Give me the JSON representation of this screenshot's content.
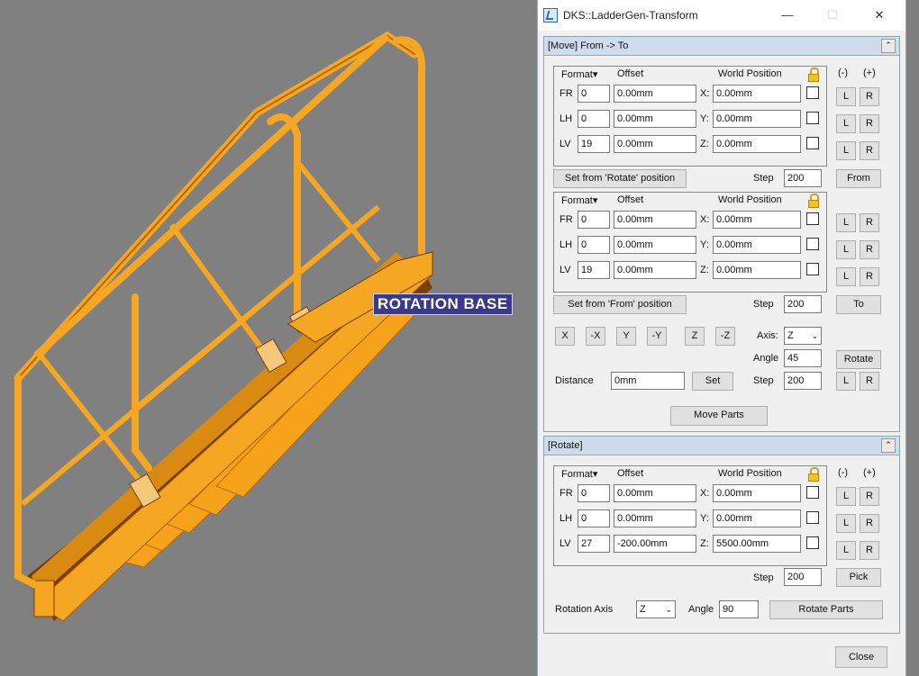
{
  "viewport": {
    "annotation": "ROTATION BASE"
  },
  "window": {
    "title": "DKS::LadderGen-Transform",
    "minimize": "—",
    "maximize": "☐",
    "close": "✕"
  },
  "move_panel": {
    "header": "[Move] From -> To",
    "collapse": "⌃",
    "minus": "(-)",
    "plus": "(+)",
    "from_group": {
      "format": "Format▾",
      "offset": "Offset",
      "world": "World Position",
      "rows": [
        {
          "label": "FR",
          "idx": "0",
          "offset": "0.00mm",
          "axis": "X:",
          "world": "0.00mm"
        },
        {
          "label": "LH",
          "idx": "0",
          "offset": "0.00mm",
          "axis": "Y:",
          "world": "0.00mm"
        },
        {
          "label": "LV",
          "idx": "19",
          "offset": "0.00mm",
          "axis": "Z:",
          "world": "0.00mm"
        }
      ]
    },
    "set_from_rotate": "Set from 'Rotate' position",
    "step_label": "Step",
    "from_step": "200",
    "from_btn": "From",
    "to_group": {
      "format": "Format▾",
      "offset": "Offset",
      "world": "World Position",
      "rows": [
        {
          "label": "FR",
          "idx": "0",
          "offset": "0.00mm",
          "axis": "X:",
          "world": "0.00mm"
        },
        {
          "label": "LH",
          "idx": "0",
          "offset": "0.00mm",
          "axis": "Y:",
          "world": "0.00mm"
        },
        {
          "label": "LV",
          "idx": "19",
          "offset": "0.00mm",
          "axis": "Z:",
          "world": "0.00mm"
        }
      ]
    },
    "set_from_from": "Set from 'From' position",
    "to_step": "200",
    "to_btn": "To",
    "axis_buttons": [
      "X",
      "-X",
      "Y",
      "-Y",
      "Z",
      "-Z"
    ],
    "axis_label": "Axis:",
    "axis_value": "Z",
    "angle_label": "Angle",
    "angle_value": "45",
    "rotate_btn": "Rotate",
    "distance_label": "Distance",
    "distance_value": "0mm",
    "set_btn": "Set",
    "rot_step": "200",
    "move_parts": "Move Parts",
    "L": "L",
    "R": "R"
  },
  "rotate_panel": {
    "header": "[Rotate]",
    "collapse": "⌃",
    "minus": "(-)",
    "plus": "(+)",
    "format": "Format▾",
    "offset": "Offset",
    "world": "World Position",
    "rows": [
      {
        "label": "FR",
        "idx": "0",
        "offset": "0.00mm",
        "axis": "X:",
        "world": "0.00mm"
      },
      {
        "label": "LH",
        "idx": "0",
        "offset": "0.00mm",
        "axis": "Y:",
        "world": "0.00mm"
      },
      {
        "label": "LV",
        "idx": "27",
        "offset": "-200.00mm",
        "axis": "Z:",
        "world": "5500.00mm"
      }
    ],
    "step_label": "Step",
    "step_value": "200",
    "pick_btn": "Pick",
    "rotation_axis_label": "Rotation Axis",
    "rotation_axis_value": "Z",
    "angle_label": "Angle",
    "angle_value": "90",
    "rotate_parts": "Rotate Parts",
    "L": "L",
    "R": "R"
  },
  "close_btn": "Close",
  "colors": {
    "ladder": "#f5a623",
    "ladder_dark": "#8a4a00",
    "panel_head": "#cfdceb",
    "label_bg": "#3a3a8c"
  }
}
